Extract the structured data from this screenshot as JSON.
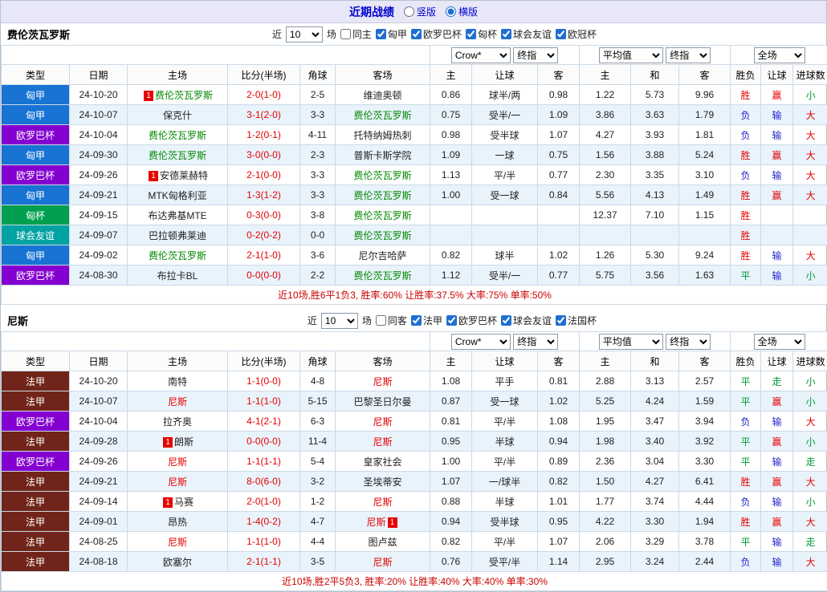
{
  "header": {
    "title": "近期战绩",
    "layout_options": [
      "竖版",
      "横版"
    ],
    "selected_layout": "横版"
  },
  "colors": {
    "win_red": "#e60000",
    "lose_blue": "#2323cc",
    "draw_green": "#009933",
    "score_red": "#e60000",
    "summary_red": "#cc0000",
    "title_blue": "#0000cc",
    "topbar_bg": "#e7e7f8",
    "alt_row_bg": "#e9f3fc"
  },
  "league_colors": {
    "匈甲": "#1873d3",
    "欧罗巴杯": "#8400d0",
    "匈杯": "#00a050",
    "球会友谊": "#00a2a2",
    "法甲": "#71251a"
  },
  "columns": [
    "类型",
    "日期",
    "主场",
    "比分(半场)",
    "角球",
    "客场",
    "主",
    "让球",
    "客",
    "主",
    "和",
    "客",
    "胜负",
    "让球",
    "进球数"
  ],
  "column_keys": [
    "type",
    "date",
    "home",
    "score",
    "corners",
    "away",
    "odds-home",
    "handicap",
    "odds-away",
    "avg-home",
    "avg-draw",
    "avg-away",
    "result",
    "handicap-result",
    "goals"
  ],
  "selects": {
    "book": "Crow*",
    "stage1": "终指",
    "avg": "平均值",
    "stage2": "终指",
    "scope": "全场"
  },
  "sections": [
    {
      "team": "费伦茨瓦罗斯",
      "subject_color": "#008800",
      "filter": {
        "near": "近",
        "count": "10",
        "games": "场",
        "same": "同主",
        "leagues": [
          "匈甲",
          "欧罗巴杯",
          "匈杯",
          "球会友谊",
          "欧冠杯"
        ]
      },
      "summary": "近10场,胜6平1负3, 胜率:60% 让胜率:37.5% 大率:75% 单率:50%",
      "rows": [
        {
          "lg": "匈甲",
          "date": "24-10-20",
          "home": {
            "n": "费伦茨瓦罗斯",
            "s": true,
            "b": "1"
          },
          "score": "2-0(1-0)",
          "cn": "2-5",
          "away": {
            "n": "维迪奥顿"
          },
          "o": [
            "0.86",
            "球半/两",
            "0.98"
          ],
          "avg": [
            "1.22",
            "5.73",
            "9.96"
          ],
          "res": [
            [
              "胜",
              "r"
            ],
            [
              "赢",
              "r"
            ],
            [
              "小",
              "g"
            ]
          ]
        },
        {
          "lg": "匈甲",
          "date": "24-10-07",
          "home": {
            "n": "保克什"
          },
          "score": "3-1(2-0)",
          "cn": "3-3",
          "away": {
            "n": "费伦茨瓦罗斯",
            "s": true
          },
          "o": [
            "0.75",
            "受半/一",
            "1.09"
          ],
          "avg": [
            "3.86",
            "3.63",
            "1.79"
          ],
          "res": [
            [
              "负",
              "b"
            ],
            [
              "输",
              "b"
            ],
            [
              "大",
              "r"
            ]
          ]
        },
        {
          "lg": "欧罗巴杯",
          "date": "24-10-04",
          "home": {
            "n": "费伦茨瓦罗斯",
            "s": true
          },
          "score": "1-2(0-1)",
          "cn": "4-11",
          "away": {
            "n": "托特纳姆热刺"
          },
          "o": [
            "0.98",
            "受半球",
            "1.07"
          ],
          "avg": [
            "4.27",
            "3.93",
            "1.81"
          ],
          "res": [
            [
              "负",
              "b"
            ],
            [
              "输",
              "b"
            ],
            [
              "大",
              "r"
            ]
          ]
        },
        {
          "lg": "匈甲",
          "date": "24-09-30",
          "home": {
            "n": "费伦茨瓦罗斯",
            "s": true
          },
          "score": "3-0(0-0)",
          "cn": "2-3",
          "away": {
            "n": "普斯卡斯学院"
          },
          "o": [
            "1.09",
            "一球",
            "0.75"
          ],
          "avg": [
            "1.56",
            "3.88",
            "5.24"
          ],
          "res": [
            [
              "胜",
              "r"
            ],
            [
              "赢",
              "r"
            ],
            [
              "大",
              "r"
            ]
          ]
        },
        {
          "lg": "欧罗巴杯",
          "date": "24-09-26",
          "home": {
            "n": "安德莱赫特",
            "b": "1"
          },
          "score": "2-1(0-0)",
          "cn": "3-3",
          "away": {
            "n": "费伦茨瓦罗斯",
            "s": true
          },
          "o": [
            "1.13",
            "平/半",
            "0.77"
          ],
          "avg": [
            "2.30",
            "3.35",
            "3.10"
          ],
          "res": [
            [
              "负",
              "b"
            ],
            [
              "输",
              "b"
            ],
            [
              "大",
              "r"
            ]
          ]
        },
        {
          "lg": "匈甲",
          "date": "24-09-21",
          "home": {
            "n": "MTK匈格利亚"
          },
          "score": "1-3(1-2)",
          "cn": "3-3",
          "away": {
            "n": "费伦茨瓦罗斯",
            "s": true
          },
          "o": [
            "1.00",
            "受一球",
            "0.84"
          ],
          "avg": [
            "5.56",
            "4.13",
            "1.49"
          ],
          "res": [
            [
              "胜",
              "r"
            ],
            [
              "赢",
              "r"
            ],
            [
              "大",
              "r"
            ]
          ]
        },
        {
          "lg": "匈杯",
          "date": "24-09-15",
          "home": {
            "n": "布达弗基MTE"
          },
          "score": "0-3(0-0)",
          "cn": "3-8",
          "away": {
            "n": "费伦茨瓦罗斯",
            "s": true
          },
          "o": [
            "",
            "",
            ""
          ],
          "avg": [
            "12.37",
            "7.10",
            "1.15"
          ],
          "res": [
            [
              "胜",
              "r"
            ],
            [
              "",
              ""
            ],
            [
              "",
              ""
            ]
          ]
        },
        {
          "lg": "球会友谊",
          "date": "24-09-07",
          "home": {
            "n": "巴拉顿弗莱迪"
          },
          "score": "0-2(0-2)",
          "cn": "0-0",
          "away": {
            "n": "费伦茨瓦罗斯",
            "s": true
          },
          "o": [
            "",
            "",
            ""
          ],
          "avg": [
            "",
            "",
            ""
          ],
          "res": [
            [
              "胜",
              "r"
            ],
            [
              "",
              ""
            ],
            [
              "",
              ""
            ]
          ]
        },
        {
          "lg": "匈甲",
          "date": "24-09-02",
          "home": {
            "n": "费伦茨瓦罗斯",
            "s": true
          },
          "score": "2-1(1-0)",
          "cn": "3-6",
          "away": {
            "n": "尼尔吉哈萨"
          },
          "o": [
            "0.82",
            "球半",
            "1.02"
          ],
          "avg": [
            "1.26",
            "5.30",
            "9.24"
          ],
          "res": [
            [
              "胜",
              "r"
            ],
            [
              "输",
              "b"
            ],
            [
              "大",
              "r"
            ]
          ]
        },
        {
          "lg": "欧罗巴杯",
          "date": "24-08-30",
          "home": {
            "n": "布拉卡BL"
          },
          "score": "0-0(0-0)",
          "cn": "2-2",
          "away": {
            "n": "费伦茨瓦罗斯",
            "s": true
          },
          "o": [
            "1.12",
            "受半/一",
            "0.77"
          ],
          "avg": [
            "5.75",
            "3.56",
            "1.63"
          ],
          "res": [
            [
              "平",
              "g"
            ],
            [
              "输",
              "b"
            ],
            [
              "小",
              "g"
            ]
          ]
        }
      ]
    },
    {
      "team": "尼斯",
      "subject_color": "#e60000",
      "filter": {
        "near": "近",
        "count": "10",
        "games": "场",
        "same": "同客",
        "leagues": [
          "法甲",
          "欧罗巴杯",
          "球会友谊",
          "法国杯"
        ]
      },
      "summary": "近10场,胜2平5负3, 胜率:20% 让胜率:40% 大率:40% 单率:30%",
      "rows": [
        {
          "lg": "法甲",
          "date": "24-10-20",
          "home": {
            "n": "南特"
          },
          "score": "1-1(0-0)",
          "cn": "4-8",
          "away": {
            "n": "尼斯",
            "s": true
          },
          "o": [
            "1.08",
            "平手",
            "0.81"
          ],
          "avg": [
            "2.88",
            "3.13",
            "2.57"
          ],
          "res": [
            [
              "平",
              "g"
            ],
            [
              "走",
              "g"
            ],
            [
              "小",
              "g"
            ]
          ]
        },
        {
          "lg": "法甲",
          "date": "24-10-07",
          "home": {
            "n": "尼斯",
            "s": true
          },
          "score": "1-1(1-0)",
          "cn": "5-15",
          "away": {
            "n": "巴黎圣日尔曼"
          },
          "o": [
            "0.87",
            "受一球",
            "1.02"
          ],
          "avg": [
            "5.25",
            "4.24",
            "1.59"
          ],
          "res": [
            [
              "平",
              "g"
            ],
            [
              "赢",
              "r"
            ],
            [
              "小",
              "g"
            ]
          ]
        },
        {
          "lg": "欧罗巴杯",
          "date": "24-10-04",
          "home": {
            "n": "拉齐奥"
          },
          "score": "4-1(2-1)",
          "cn": "6-3",
          "away": {
            "n": "尼斯",
            "s": true
          },
          "o": [
            "0.81",
            "平/半",
            "1.08"
          ],
          "avg": [
            "1.95",
            "3.47",
            "3.94"
          ],
          "res": [
            [
              "负",
              "b"
            ],
            [
              "输",
              "b"
            ],
            [
              "大",
              "r"
            ]
          ]
        },
        {
          "lg": "法甲",
          "date": "24-09-28",
          "home": {
            "n": "朗斯",
            "b": "1"
          },
          "score": "0-0(0-0)",
          "cn": "11-4",
          "away": {
            "n": "尼斯",
            "s": true
          },
          "o": [
            "0.95",
            "半球",
            "0.94"
          ],
          "avg": [
            "1.98",
            "3.40",
            "3.92"
          ],
          "res": [
            [
              "平",
              "g"
            ],
            [
              "赢",
              "r"
            ],
            [
              "小",
              "g"
            ]
          ]
        },
        {
          "lg": "欧罗巴杯",
          "date": "24-09-26",
          "home": {
            "n": "尼斯",
            "s": true
          },
          "score": "1-1(1-1)",
          "cn": "5-4",
          "away": {
            "n": "皇家社会"
          },
          "o": [
            "1.00",
            "平/半",
            "0.89"
          ],
          "avg": [
            "2.36",
            "3.04",
            "3.30"
          ],
          "res": [
            [
              "平",
              "g"
            ],
            [
              "输",
              "b"
            ],
            [
              "走",
              "g"
            ]
          ]
        },
        {
          "lg": "法甲",
          "date": "24-09-21",
          "home": {
            "n": "尼斯",
            "s": true
          },
          "score": "8-0(6-0)",
          "cn": "3-2",
          "away": {
            "n": "圣埃蒂安"
          },
          "o": [
            "1.07",
            "一/球半",
            "0.82"
          ],
          "avg": [
            "1.50",
            "4.27",
            "6.41"
          ],
          "res": [
            [
              "胜",
              "r"
            ],
            [
              "赢",
              "r"
            ],
            [
              "大",
              "r"
            ]
          ]
        },
        {
          "lg": "法甲",
          "date": "24-09-14",
          "home": {
            "n": "马赛",
            "b": "1"
          },
          "score": "2-0(1-0)",
          "cn": "1-2",
          "away": {
            "n": "尼斯",
            "s": true
          },
          "o": [
            "0.88",
            "半球",
            "1.01"
          ],
          "avg": [
            "1.77",
            "3.74",
            "4.44"
          ],
          "res": [
            [
              "负",
              "b"
            ],
            [
              "输",
              "b"
            ],
            [
              "小",
              "g"
            ]
          ]
        },
        {
          "lg": "法甲",
          "date": "24-09-01",
          "home": {
            "n": "昂热"
          },
          "score": "1-4(0-2)",
          "cn": "4-7",
          "away": {
            "n": "尼斯",
            "s": true,
            "b": "1",
            "bp": "right"
          },
          "o": [
            "0.94",
            "受半球",
            "0.95"
          ],
          "avg": [
            "4.22",
            "3.30",
            "1.94"
          ],
          "res": [
            [
              "胜",
              "r"
            ],
            [
              "赢",
              "r"
            ],
            [
              "大",
              "r"
            ]
          ]
        },
        {
          "lg": "法甲",
          "date": "24-08-25",
          "home": {
            "n": "尼斯",
            "s": true
          },
          "score": "1-1(1-0)",
          "cn": "4-4",
          "away": {
            "n": "图卢兹"
          },
          "o": [
            "0.82",
            "平/半",
            "1.07"
          ],
          "avg": [
            "2.06",
            "3.29",
            "3.78"
          ],
          "res": [
            [
              "平",
              "g"
            ],
            [
              "输",
              "b"
            ],
            [
              "走",
              "g"
            ]
          ]
        },
        {
          "lg": "法甲",
          "date": "24-08-18",
          "home": {
            "n": "欧塞尔"
          },
          "score": "2-1(1-1)",
          "cn": "3-5",
          "away": {
            "n": "尼斯",
            "s": true
          },
          "o": [
            "0.76",
            "受平/半",
            "1.14"
          ],
          "avg": [
            "2.95",
            "3.24",
            "2.44"
          ],
          "res": [
            [
              "负",
              "b"
            ],
            [
              "输",
              "b"
            ],
            [
              "大",
              "r"
            ]
          ]
        }
      ]
    }
  ]
}
